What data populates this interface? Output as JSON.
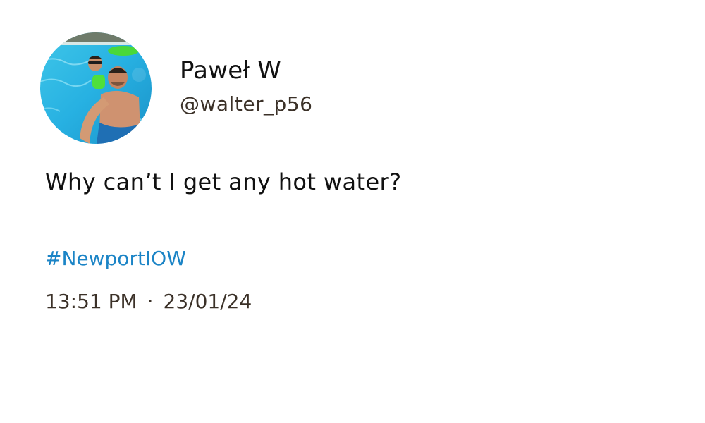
{
  "post": {
    "author": {
      "display_name": "Paweł W",
      "handle": "@walter_p56",
      "avatar": "avatar-photo"
    },
    "text": "Why can’t I get any hot water?",
    "hashtag": "#NewportIOW",
    "time": "13:51 PM",
    "separator": "·",
    "date": "23/01/24"
  },
  "colors": {
    "name": "#111111",
    "handle": "#3b3128",
    "hashtag": "#1b84c6",
    "meta": "#3b3128",
    "background": "#ffffff"
  }
}
